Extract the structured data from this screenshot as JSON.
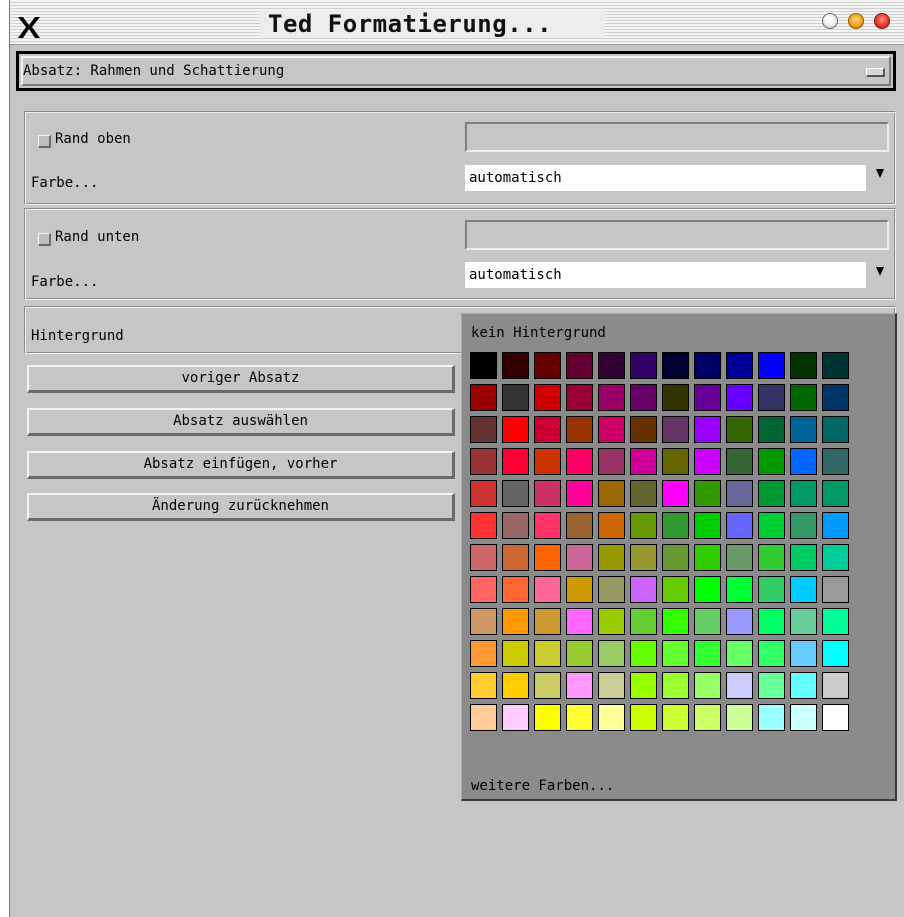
{
  "window": {
    "title": "Ted Formatierung...",
    "x_icon": "x-window-icon"
  },
  "panel_select": {
    "label": "Absatz: Rahmen und Schattierung"
  },
  "top_border": {
    "checkbox_label": "Rand oben",
    "width_value": "",
    "color_link": "Farbe...",
    "color_value": "automatisch"
  },
  "bottom_border": {
    "checkbox_label": "Rand unten",
    "width_value": "",
    "color_link": "Farbe...",
    "color_value": "automatisch"
  },
  "background": {
    "label": "Hintergrund"
  },
  "buttons": {
    "prev_paragraph": "voriger Absatz",
    "select_paragraph": "Absatz auswählen",
    "insert_before": "Absatz einfügen, vorher",
    "undo_change": "Änderung zurücknehmen"
  },
  "palette": {
    "none_label": "kein Hintergrund",
    "more_label": "weitere Farben...",
    "colors": [
      [
        "#000000",
        "#330000",
        "#660000",
        "#660033",
        "#330033",
        "#330066",
        "#000033",
        "#000066",
        "#000099",
        "#0000ff",
        "#003300",
        "#003333"
      ],
      [
        "#990000",
        "#333333",
        "#cc0000",
        "#990033",
        "#990066",
        "#660066",
        "#333300",
        "#660099",
        "#6600ff",
        "#333366",
        "#006600",
        "#003366"
      ],
      [
        "#663333",
        "#ff0000",
        "#cc0033",
        "#993300",
        "#cc0066",
        "#663300",
        "#663366",
        "#9900ff",
        "#336600",
        "#006633",
        "#006699",
        "#006666"
      ],
      [
        "#993333",
        "#ff0033",
        "#cc3300",
        "#ff0066",
        "#993366",
        "#cc0099",
        "#666600",
        "#cc00ff",
        "#336633",
        "#009900",
        "#0066ff",
        "#336666"
      ],
      [
        "#cc3333",
        "#666666",
        "#cc3366",
        "#ff0099",
        "#996600",
        "#666633",
        "#ff00ff",
        "#339900",
        "#666699",
        "#009933",
        "#009966",
        "#009966"
      ],
      [
        "#ff3333",
        "#996666",
        "#ff3366",
        "#996633",
        "#cc6600",
        "#669900",
        "#339933",
        "#00cc00",
        "#6666ff",
        "#00cc33",
        "#339966",
        "#0099ff"
      ],
      [
        "#cc6666",
        "#cc6633",
        "#ff6600",
        "#cc6699",
        "#999900",
        "#999933",
        "#669933",
        "#33cc00",
        "#669966",
        "#33cc33",
        "#00cc66",
        "#00cc99"
      ],
      [
        "#ff6666",
        "#ff6633",
        "#ff6699",
        "#cc9900",
        "#999966",
        "#cc66ff",
        "#66cc00",
        "#00ff00",
        "#00ff33",
        "#33cc66",
        "#00ccff",
        "#999999"
      ],
      [
        "#cc9966",
        "#ff9900",
        "#cc9933",
        "#ff66ff",
        "#99cc00",
        "#66cc33",
        "#33ff00",
        "#66cc66",
        "#9999ff",
        "#00ff66",
        "#66cc99",
        "#00ff99"
      ],
      [
        "#ff9933",
        "#cccc00",
        "#cccc33",
        "#99cc33",
        "#99cc66",
        "#66ff00",
        "#66ff33",
        "#33ff33",
        "#66ff66",
        "#33ff66",
        "#66ccff",
        "#00ffff"
      ],
      [
        "#ffcc33",
        "#ffcc00",
        "#cccc66",
        "#ff99ff",
        "#cccc99",
        "#99ff00",
        "#99ff33",
        "#99ff66",
        "#ccccff",
        "#66ff99",
        "#66ffff",
        "#cccccc"
      ],
      [
        "#ffcc99",
        "#ffccff",
        "#ffff00",
        "#ffff33",
        "#ffff99",
        "#ccff00",
        "#ccff33",
        "#ccff66",
        "#ccff99",
        "#99ffff",
        "#ccffff",
        "#ffffff"
      ]
    ]
  }
}
